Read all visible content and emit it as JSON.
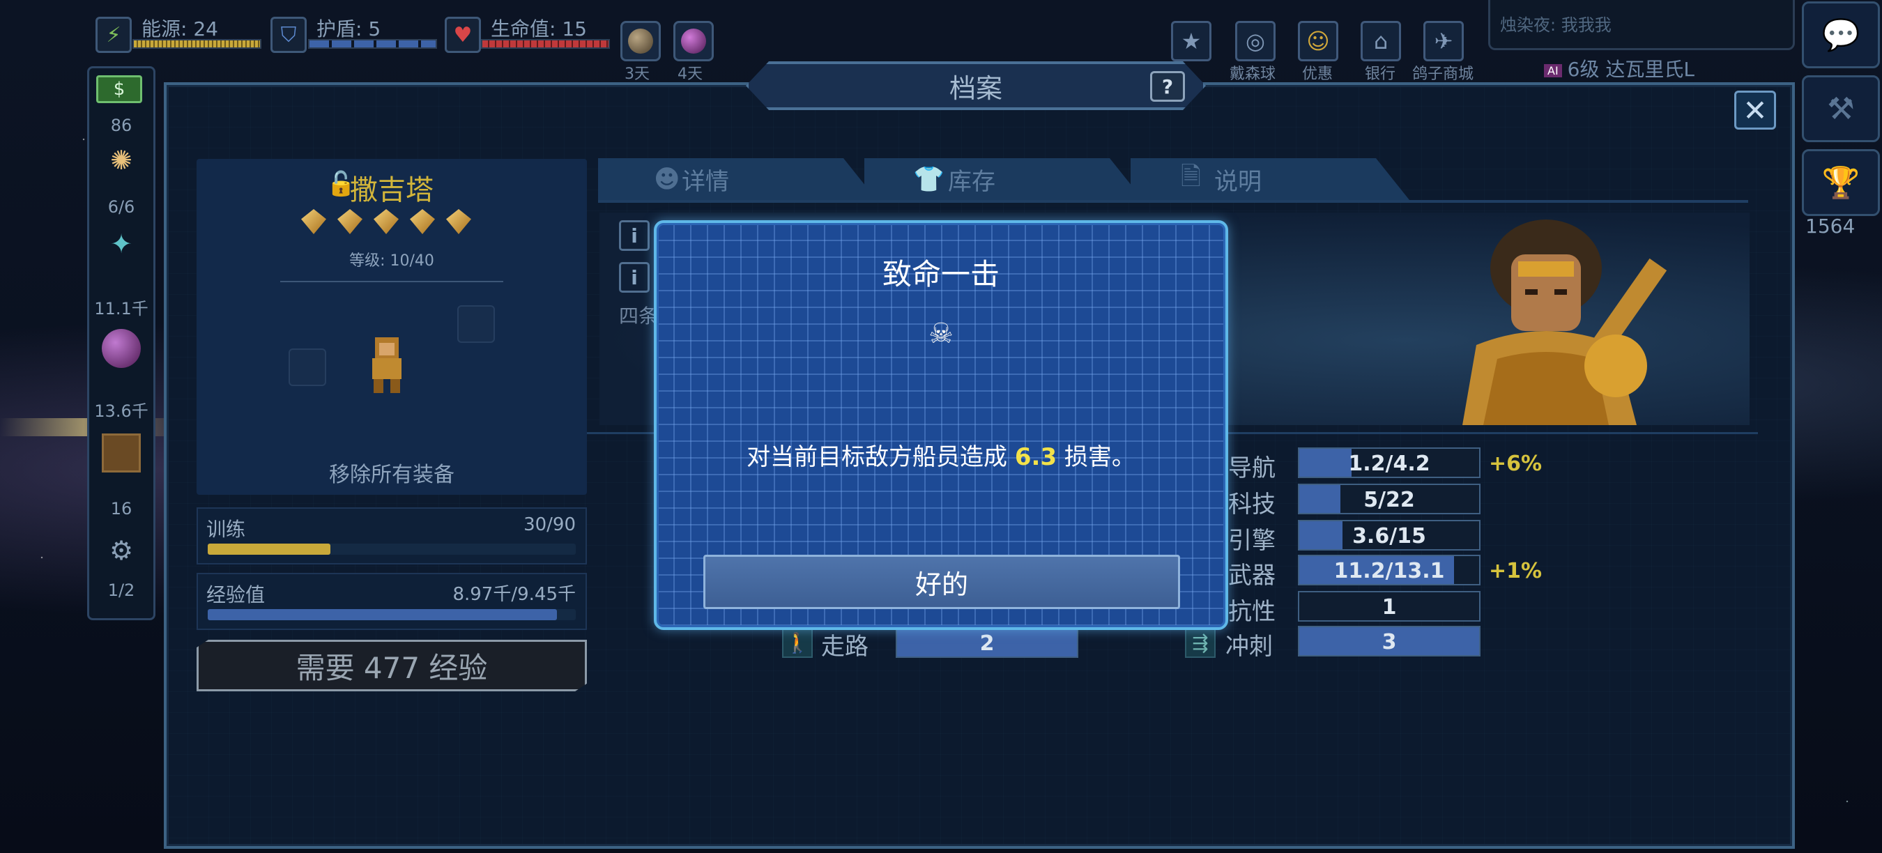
{
  "hud": {
    "energy": {
      "label": "能源: 24",
      "fill": 1.0
    },
    "shield": {
      "label": "护盾: 5",
      "fill": 1.0
    },
    "health": {
      "label": "生命值: 15",
      "fill": 1.0
    },
    "planet1_days": "3天",
    "planet2_days": "4天",
    "buttons": [
      {
        "label": "",
        "icon": "star-icon"
      },
      {
        "label": "戴森球",
        "icon": "dyson-sphere-icon"
      },
      {
        "label": "优惠",
        "icon": "smiley-icon"
      },
      {
        "label": "银行",
        "icon": "bank-icon"
      },
      {
        "label": "鸽子商城",
        "icon": "bird-icon"
      }
    ],
    "chat_text": "烛染夜: 我我我",
    "player_tag": "AI",
    "player_info": "6级 达瓦里氏L",
    "trophy_score": "1564"
  },
  "sidebar": {
    "money": "86",
    "crew": "6/6",
    "crystals": "11.1千",
    "gas": "13.6千",
    "supplies": "16",
    "modules": "1/2"
  },
  "window": {
    "title": "档案",
    "help": "?"
  },
  "crew": {
    "name": "撒吉塔",
    "stars": 5,
    "level": "等级: 10/40",
    "remove_equipment": "移除所有装备",
    "training_label": "训练",
    "training_value": "30/90",
    "training_fill": 0.333,
    "xp_label": "经验值",
    "xp_value": "8.97千/9.45千",
    "xp_fill": 0.949,
    "need_xp": "需要 477 经验"
  },
  "tabs": [
    {
      "label": "详情",
      "icon": "person-icon"
    },
    {
      "label": "库存",
      "icon": "shirt-icon"
    },
    {
      "label": "说明",
      "icon": "document-icon"
    }
  ],
  "ability_partial": "四条",
  "stats": [
    {
      "label": "导航",
      "value": "1.2/4.2",
      "fill": 0.29,
      "bonus": "+6%"
    },
    {
      "label": "科技",
      "value": "5/22",
      "fill": 0.23,
      "bonus": ""
    },
    {
      "label": "引擎",
      "value": "3.6/15",
      "fill": 0.24,
      "bonus": ""
    },
    {
      "label": "武器",
      "value": "11.2/13.1",
      "fill": 0.86,
      "bonus": "+1%"
    },
    {
      "label": "抗性",
      "value": "1",
      "fill": 0.0,
      "bonus": ""
    },
    {
      "label": "冲刺",
      "value": "3",
      "fill": 1.0,
      "bonus": ""
    }
  ],
  "walk": {
    "label": "走路",
    "value": "2"
  },
  "modal": {
    "title": "致命一击",
    "icon": "skull-crossbones-icon",
    "body_prefix": "对当前目标敌方船员造成 ",
    "body_value": "6.3",
    "body_suffix": " 损害。",
    "ok_label": "好的"
  },
  "colors": {
    "energy": "#c9a93a",
    "shield": "#3d63a8",
    "health": "#c0393b",
    "training": "#c9a93a",
    "xp": "#3d63a8",
    "crew_name": "#d2b53a",
    "modal_bg": "#1d4a95",
    "highlight": "#f3e24a"
  }
}
